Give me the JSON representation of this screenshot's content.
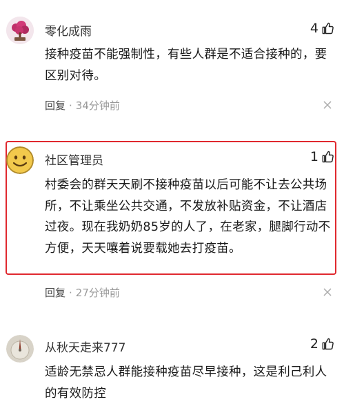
{
  "comments": [
    {
      "username": "零化成雨",
      "likes": "4",
      "text": "接种疫苗不能强制性，有些人群是不适合接种的，要区别对待。",
      "reply": "回复",
      "time": "34分钟前",
      "avatar_color": "#c0306a",
      "avatar_icon": "bonsai-avatar"
    },
    {
      "username": "社区管理员",
      "likes": "1",
      "text": "村委会的群天天刷不接种疫苗以后可能不让去公共场所，不让乘坐公共交通，不发放补贴资金，不让酒店过夜。现在我奶奶85岁的人了，在老家，腿脚行动不方便，天天嚷着说要载她去打疫苗。",
      "reply": "回复",
      "time": "27分钟前",
      "avatar_color": "#f2c94c",
      "avatar_icon": "smiley-avatar",
      "highlighted": true
    },
    {
      "username": "从秋天走来777",
      "likes": "2",
      "text": "适龄无禁忌人群能接种疫苗尽早接种，这是利己利人的有效防控",
      "avatar_color": "#c9c4b8",
      "avatar_icon": "sundial-avatar"
    }
  ],
  "highlight_color": "#e0282e"
}
